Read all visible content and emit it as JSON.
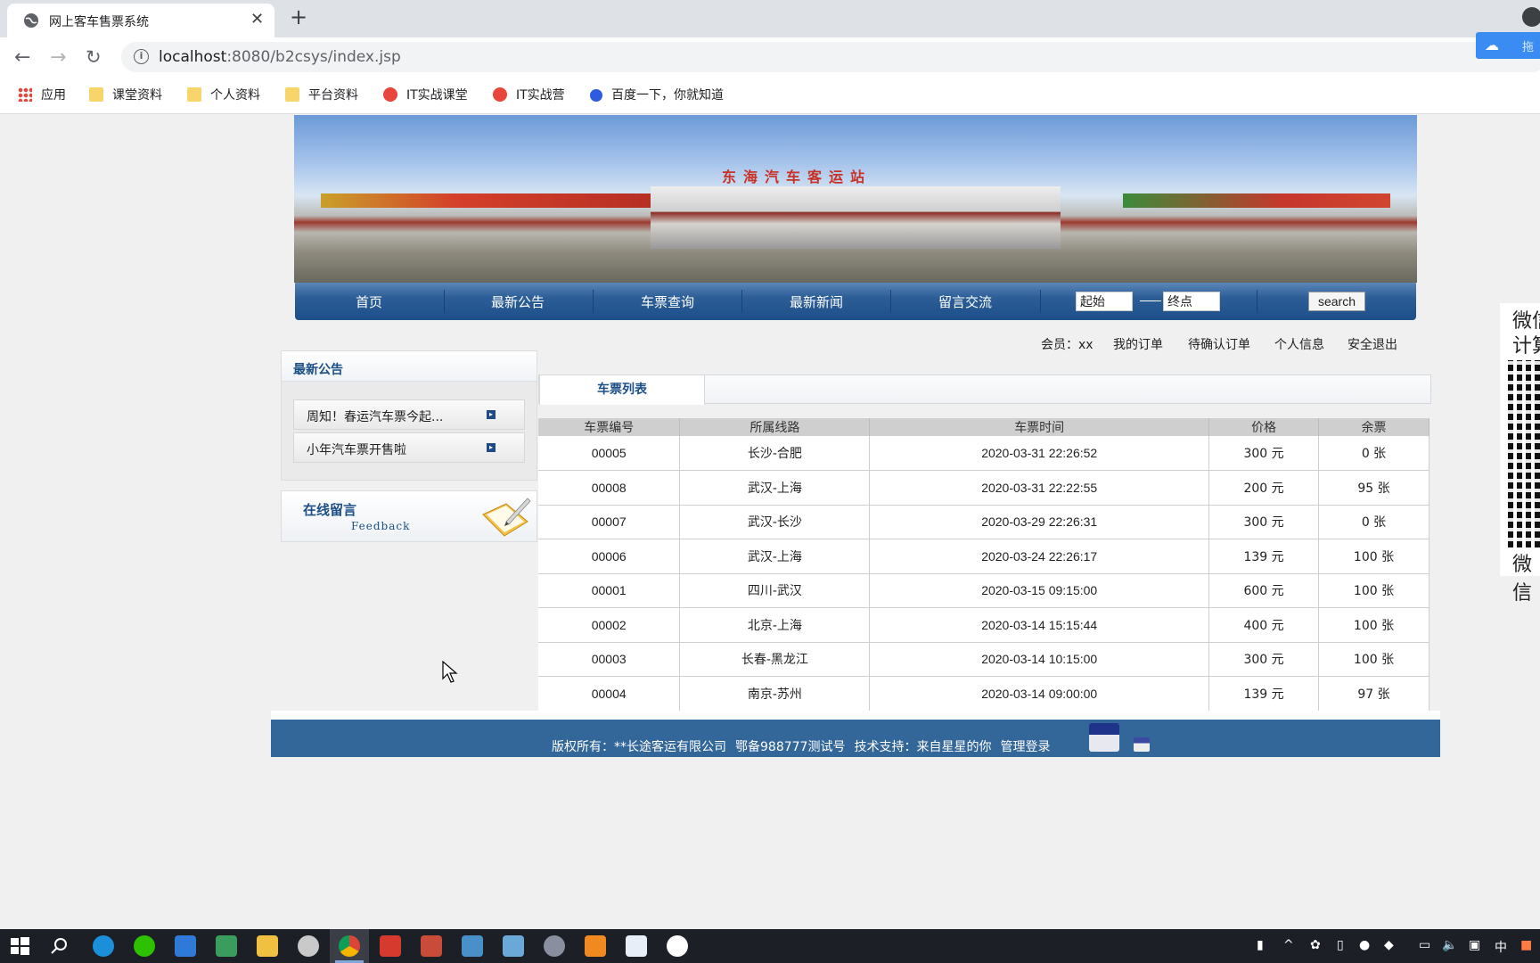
{
  "browser": {
    "tab_title": "网上客车售票系统",
    "url_host": "localhost",
    "url_rest": ":8080/b2csys/index.jsp",
    "extension_label": "拖"
  },
  "bookmarks": [
    {
      "label": "应用",
      "icon": "apps-icon"
    },
    {
      "label": "课堂资料",
      "icon": "folder-icon"
    },
    {
      "label": "个人资料",
      "icon": "folder-icon"
    },
    {
      "label": "平台资料",
      "icon": "folder-icon"
    },
    {
      "label": "IT实战课堂",
      "icon": "red-circle-icon"
    },
    {
      "label": "IT实战营",
      "icon": "red-circle-icon"
    },
    {
      "label": "百度一下，你就知道",
      "icon": "baidu-paw-icon"
    }
  ],
  "banner": {
    "station_name": "东海汽车客运站"
  },
  "nav": {
    "items": [
      "首页",
      "最新公告",
      "车票查询",
      "最新新闻",
      "留言交流"
    ],
    "from_value": "起始",
    "to_value": "终点",
    "search_label": "search"
  },
  "member": {
    "member_text": "会员：xx",
    "links": [
      "我的订单",
      "待确认订单",
      "个人信息",
      "安全退出"
    ]
  },
  "notice": {
    "title": "最新公告",
    "items": [
      "周知！春运汽车票今起...",
      "小年汽车票开售啦"
    ]
  },
  "feedback": {
    "title_cn": "在线留言",
    "title_en": "Feedback"
  },
  "tickets": {
    "tab_label": "车票列表",
    "headers": [
      "车票编号",
      "所属线路",
      "车票时间",
      "价格",
      "余票"
    ],
    "rows": [
      [
        "00005",
        "长沙-合肥",
        "2020-03-31 22:26:52",
        "300 元",
        "0 张"
      ],
      [
        "00008",
        "武汉-上海",
        "2020-03-31 22:22:55",
        "200 元",
        "95 张"
      ],
      [
        "00007",
        "武汉-长沙",
        "2020-03-29 22:26:31",
        "300 元",
        "0 张"
      ],
      [
        "00006",
        "武汉-上海",
        "2020-03-24 22:26:17",
        "139 元",
        "100 张"
      ],
      [
        "00001",
        "四川-武汉",
        "2020-03-15 09:15:00",
        "600 元",
        "100 张"
      ],
      [
        "00002",
        "北京-上海",
        "2020-03-14 15:15:44",
        "400 元",
        "100 张"
      ],
      [
        "00003",
        "长春-黑龙江",
        "2020-03-14 10:15:00",
        "300 元",
        "100 张"
      ],
      [
        "00004",
        "南京-苏州",
        "2020-03-14 09:00:00",
        "139 元",
        "97 张"
      ]
    ]
  },
  "footer": {
    "copyright": "版权所有：**长途客运有限公司",
    "icp": "鄂备988777测试号",
    "support": "技术支持：来自星星的你",
    "admin_login": "管理登录"
  },
  "qr_float": {
    "line1": "微信",
    "line2": "计算",
    "line3": "微信"
  },
  "taskbar": {
    "ime": "中"
  },
  "colors": {
    "nav_blue": "#1d4f8a",
    "footer_blue": "#336699",
    "heading_blue": "#1b4f86"
  }
}
